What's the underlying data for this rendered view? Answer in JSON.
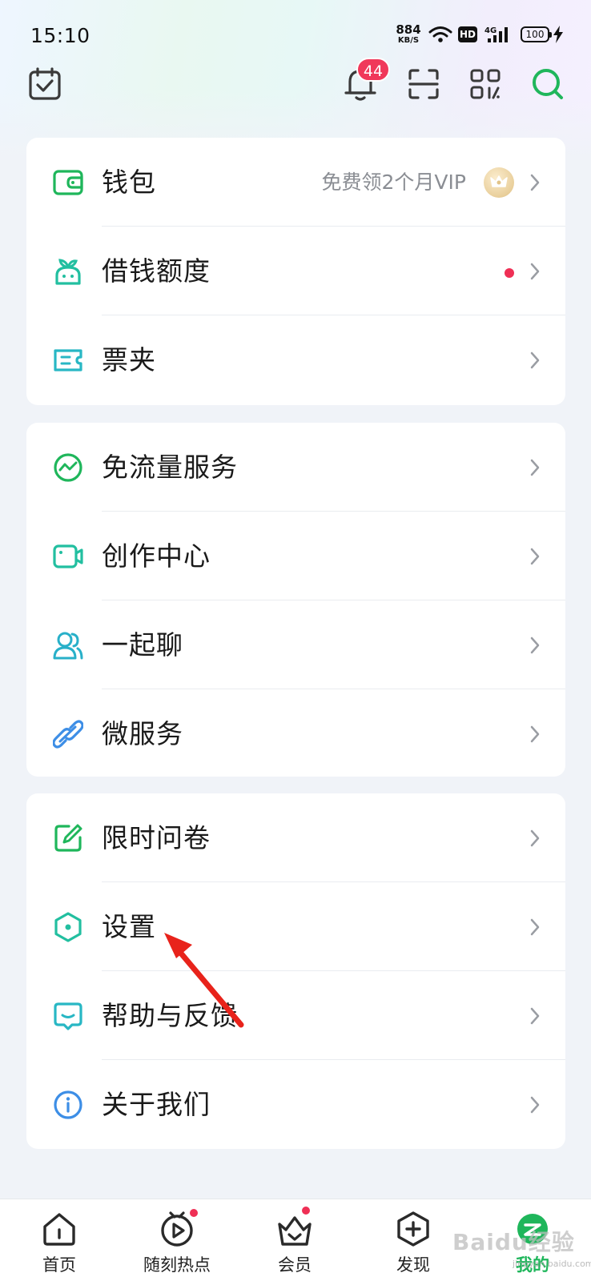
{
  "status_bar": {
    "time": "15:10",
    "net_speed": "884",
    "net_unit": "KB/S",
    "hd": "HD",
    "network": "4G",
    "battery": "100"
  },
  "header": {
    "notification_count": "44",
    "icons": [
      "calendar-check-icon",
      "bell-icon",
      "scan-icon",
      "qr-code-icon",
      "search-icon"
    ]
  },
  "colors": {
    "accent_green": "#1fb65b",
    "badge_red": "#f0385a",
    "icon_teal": "#22bfa0"
  },
  "menu_groups": [
    [
      {
        "label": "钱包",
        "extra": "免费领2个月VIP",
        "icon": "wallet-icon"
      },
      {
        "label": "借钱额度",
        "icon": "sprout-icon"
      },
      {
        "label": "票夹",
        "icon": "ticket-icon"
      }
    ],
    [
      {
        "label": "免流量服务",
        "icon": "data-trend-icon"
      },
      {
        "label": "创作中心",
        "icon": "video-camera-icon"
      },
      {
        "label": "一起聊",
        "icon": "users-icon"
      },
      {
        "label": "微服务",
        "icon": "link-icon"
      }
    ],
    [
      {
        "label": "限时问卷",
        "icon": "edit-icon"
      },
      {
        "label": "设置",
        "icon": "settings-hexagon-icon"
      },
      {
        "label": "帮助与反馈",
        "icon": "feedback-icon"
      },
      {
        "label": "关于我们",
        "icon": "info-icon"
      }
    ]
  ],
  "bottom_nav": [
    {
      "label": "首页",
      "icon": "home-icon"
    },
    {
      "label": "随刻热点",
      "icon": "play-circle-icon"
    },
    {
      "label": "会员",
      "icon": "crown-basket-icon"
    },
    {
      "label": "发现",
      "icon": "plus-hexagon-icon"
    },
    {
      "label": "我的",
      "icon": "profile-icon",
      "active": true
    }
  ],
  "watermark": {
    "text": "Baidu经验",
    "sub": "jingyan.baidu.com"
  }
}
